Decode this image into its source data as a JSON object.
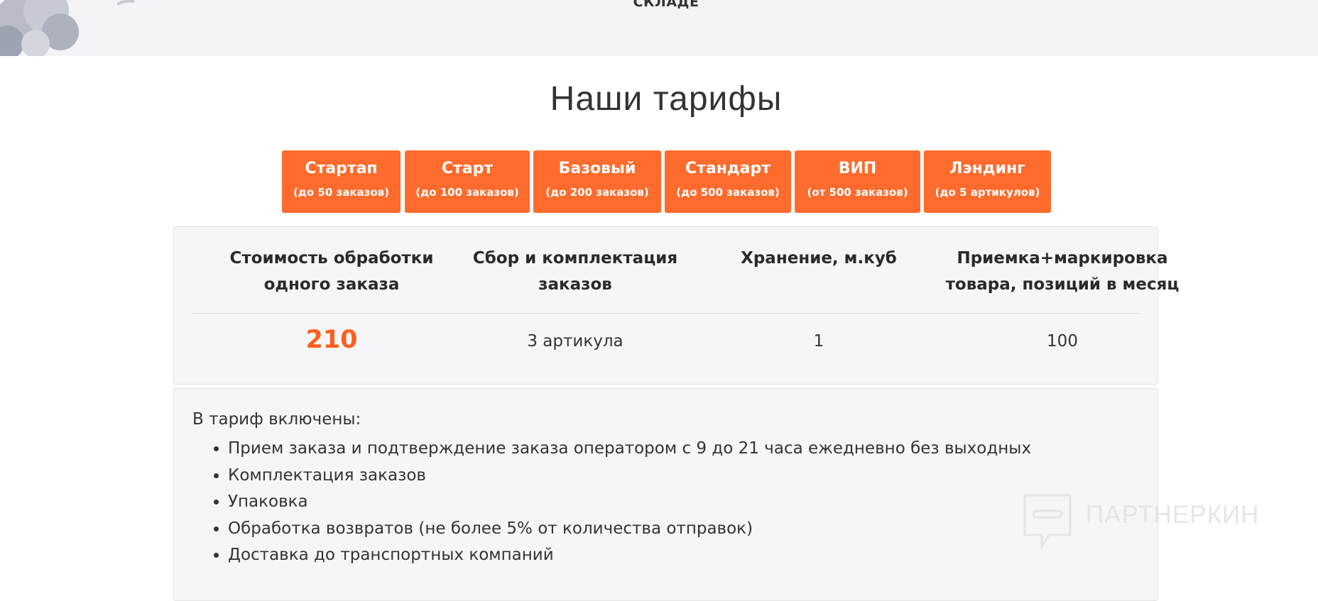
{
  "hero": {
    "caption": "СКЛАДЕ"
  },
  "section": {
    "title": "Наши тарифы"
  },
  "tabs": [
    {
      "name": "Стартап",
      "sub": "(до 50 заказов)"
    },
    {
      "name": "Старт",
      "sub": "(до 100 заказов)"
    },
    {
      "name": "Базовый",
      "sub": "(до 200 заказов)"
    },
    {
      "name": "Стандарт",
      "sub": "(до 500 заказов)"
    },
    {
      "name": "ВИП",
      "sub": "(от 500 заказов)"
    },
    {
      "name": "Лэндинг",
      "sub": "(до 5 артикулов)"
    }
  ],
  "pricing": {
    "columns": [
      {
        "head": "Стоимость обработки одного заказа",
        "value": "210"
      },
      {
        "head": "Сбор и комплектация заказов",
        "value": "3 артикула"
      },
      {
        "head": "Хранение, м.куб",
        "value": "1"
      },
      {
        "head": "Приемка+маркировка товара, позиций в месяц",
        "value": "100"
      }
    ]
  },
  "included": {
    "title": "В тариф включены:",
    "items": [
      "Прием заказа и подтверждение заказа оператором с 9 до 21 часа ежедневно без выходных",
      "Комплектация заказов",
      "Упаковка",
      "Обработка возвратов (не более 5% от количества отправок)",
      "Доставка до транспортных компаний"
    ]
  },
  "watermark": {
    "text": "ПАРТНЕРКИН"
  },
  "colors": {
    "accent": "#ff6b2d",
    "price": "#ff5e1f",
    "panel": "#f6f6f8"
  }
}
